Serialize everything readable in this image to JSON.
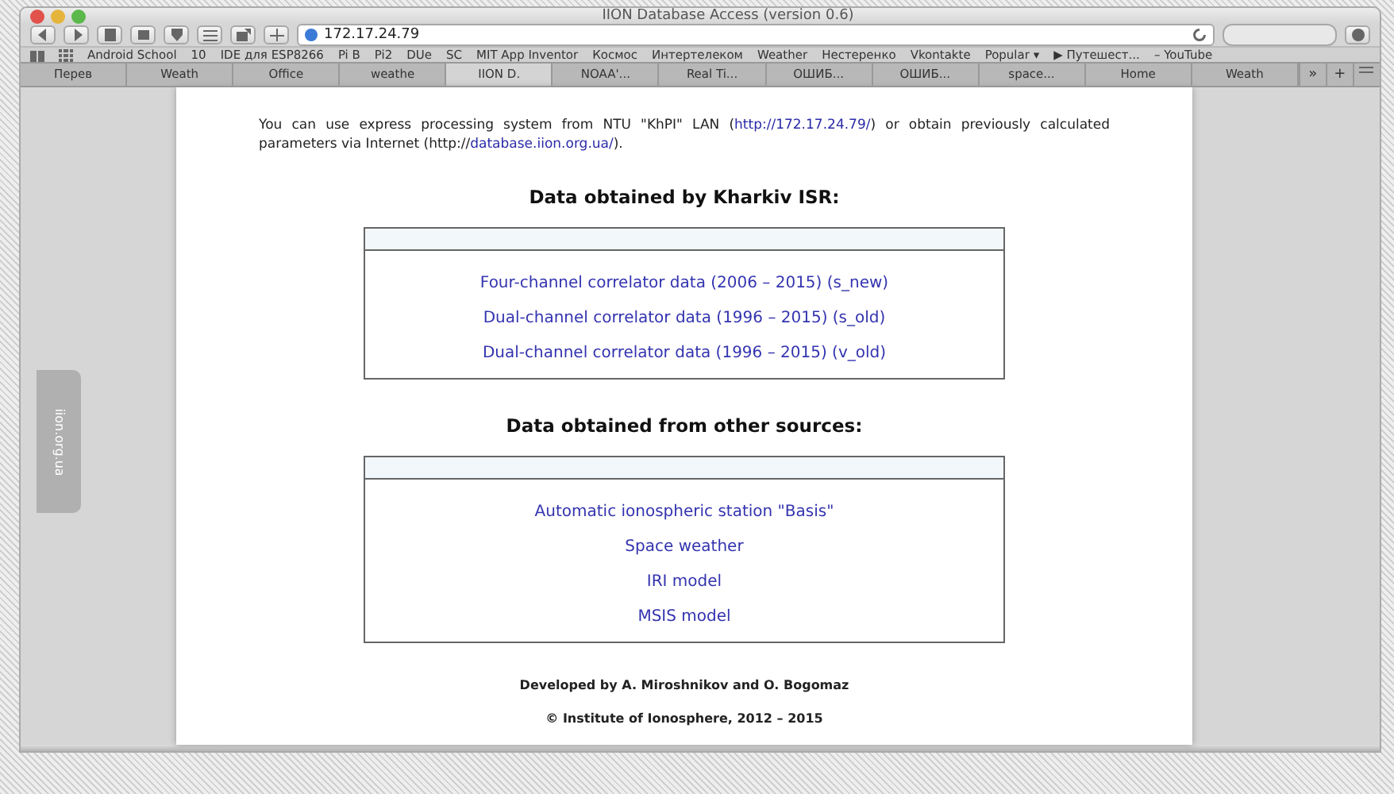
{
  "window": {
    "title": "IION Database Access (version 0.6)"
  },
  "toolbar": {
    "address": "172.17.24.79"
  },
  "bookmarks": [
    "Android School",
    "10",
    "IDE для ESP8266",
    "Pi B",
    "Pi2",
    "DUe",
    "SC",
    "MIT App Inventor",
    "Космос",
    "Интертелеком",
    "Weather",
    "Нестеренко",
    "Vkontakte",
    "Popular ▾",
    "▶ Путешест...",
    "– YouTube"
  ],
  "tabs": [
    {
      "label": "Перев",
      "selected": false
    },
    {
      "label": "Weath",
      "selected": false
    },
    {
      "label": "Office",
      "selected": false
    },
    {
      "label": "weathe",
      "selected": false
    },
    {
      "label": "IION D.",
      "selected": true
    },
    {
      "label": "NOAA'...",
      "selected": false
    },
    {
      "label": "Real Ti...",
      "selected": false
    },
    {
      "label": "ОШИБ...",
      "selected": false
    },
    {
      "label": "ОШИБ...",
      "selected": false
    },
    {
      "label": "space...",
      "selected": false
    },
    {
      "label": "Home",
      "selected": false
    },
    {
      "label": "Weath",
      "selected": false
    }
  ],
  "tab_overflow": "»",
  "new_tab": "+",
  "side_tab": "iion.org.ua",
  "intro": [
    {
      "text": "You can use express processing system from NTU \"KhPI\" LAN (",
      "link": false
    },
    {
      "text": "http://172.17.24.79/",
      "link": true
    },
    {
      "text": ") or obtain previously calculated parameters via Internet (http://",
      "link": false
    },
    {
      "text": "database.iion.org.ua/",
      "link": true
    },
    {
      "text": ").",
      "link": false
    }
  ],
  "sections": [
    {
      "heading": "Data obtained by Kharkiv ISR:",
      "links": [
        "Four-channel correlator data (2006 – 2015) (s_new)",
        "Dual-channel correlator data (1996 – 2015) (s_old)",
        "Dual-channel correlator data (1996 – 2015) (v_old)"
      ]
    },
    {
      "heading": "Data obtained from other sources:",
      "links": [
        "Automatic ionospheric station \"Basis\"",
        "Space weather",
        "IRI model",
        "MSIS model"
      ]
    }
  ],
  "footer": [
    "Developed by A. Miroshnikov and O. Bogomaz",
    "© Institute of Ionosphere, 2012 – 2015"
  ]
}
